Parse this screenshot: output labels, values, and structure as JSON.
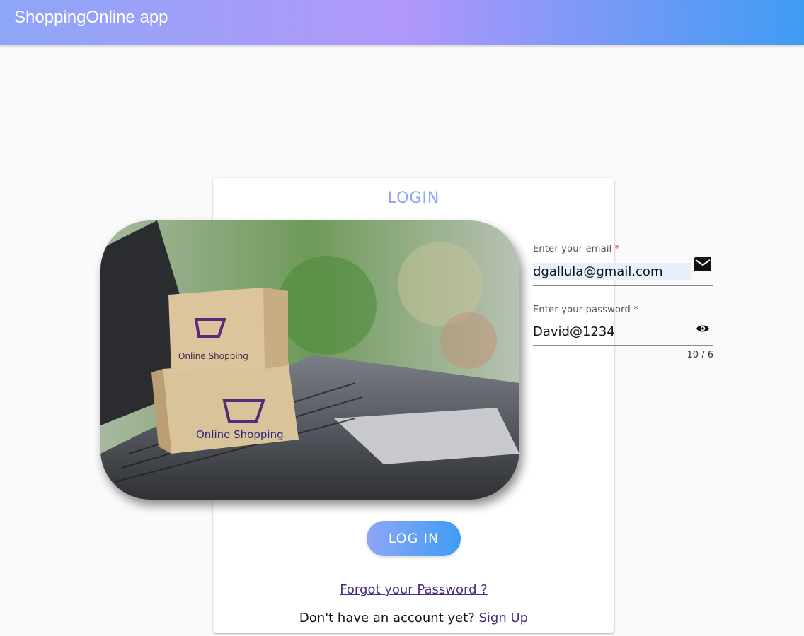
{
  "header": {
    "app_title": "ShoppingOnline app"
  },
  "card": {
    "title": "LOGIN"
  },
  "image": {
    "box_text_1": "Online Shopping",
    "box_text_2": "Online Shopping"
  },
  "email": {
    "label": "Enter your email",
    "required_mark": "*",
    "value": "dgallula@gmail.com",
    "icon": "mail-icon"
  },
  "password": {
    "label": "Enter your password",
    "required_mark": "*",
    "value": "David@1234",
    "counter": "10 / 6",
    "icon": "eye-icon"
  },
  "actions": {
    "login_label": "LOG IN",
    "forgot_label": "Forgot your Password ?",
    "no_account_text": "Don't have an account yet?",
    "signup_label": " Sign Up"
  },
  "colors": {
    "accent": "#8ea6f7",
    "accent_end": "#3e9cf3",
    "link": "#4a2a82"
  }
}
